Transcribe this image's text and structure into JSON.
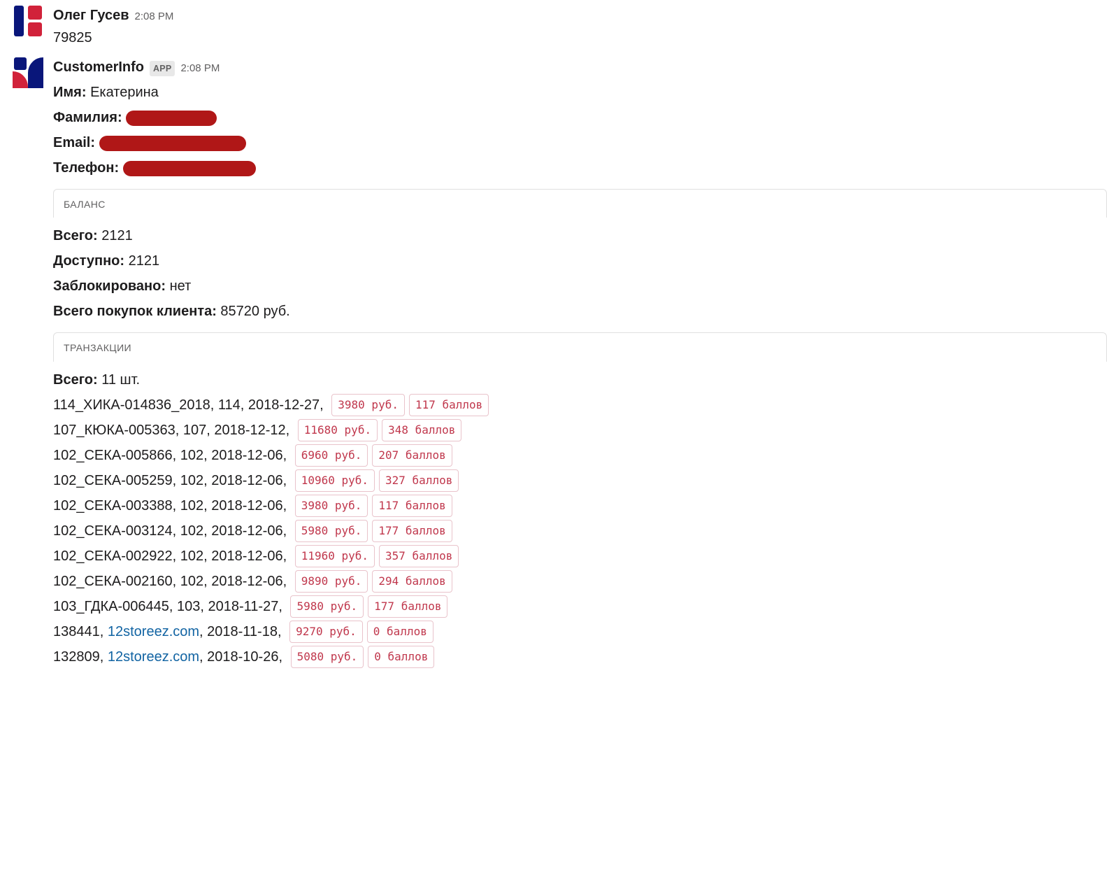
{
  "colors": {
    "redact": "#b01717",
    "tag_border": "#e9c3cb",
    "tag_text": "#c0374c",
    "link": "#1264a3"
  },
  "msg1": {
    "sender": "Олег Гусев",
    "time": "2:08 PM",
    "text": "79825"
  },
  "msg2": {
    "sender": "CustomerInfo",
    "app_badge": "APP",
    "time": "2:08 PM",
    "name_label": "Имя:",
    "name_value": "Екатерина",
    "surname_label": "Фамилия:",
    "email_label": "Email:",
    "phone_label": "Телефон:"
  },
  "balance": {
    "header": "БАЛАНС",
    "total_label": "Всего:",
    "total_value": "2121",
    "available_label": "Доступно:",
    "available_value": "2121",
    "blocked_label": "Заблокировано:",
    "blocked_value": "нет",
    "purchases_label": "Всего покупок клиента:",
    "purchases_value": "85720 руб."
  },
  "tx": {
    "header": "ТРАНЗАКЦИИ",
    "total_label": "Всего:",
    "total_value": "11 шт.",
    "items": [
      {
        "prefix": "114_ХИКА-014836_2018, 114, 2018-12-27, ",
        "link": "",
        "suffix": "",
        "amount": "3980 руб.",
        "points": "117 баллов"
      },
      {
        "prefix": "107_КЮКА-005363, 107, 2018-12-12, ",
        "link": "",
        "suffix": "",
        "amount": "11680 руб.",
        "points": "348 баллов"
      },
      {
        "prefix": "102_СЕКА-005866, 102, 2018-12-06, ",
        "link": "",
        "suffix": "",
        "amount": "6960 руб.",
        "points": "207 баллов"
      },
      {
        "prefix": "102_СЕКА-005259, 102, 2018-12-06, ",
        "link": "",
        "suffix": "",
        "amount": "10960 руб.",
        "points": "327 баллов"
      },
      {
        "prefix": "102_СЕКА-003388, 102, 2018-12-06, ",
        "link": "",
        "suffix": "",
        "amount": "3980 руб.",
        "points": "117 баллов"
      },
      {
        "prefix": "102_СЕКА-003124, 102, 2018-12-06, ",
        "link": "",
        "suffix": "",
        "amount": "5980 руб.",
        "points": "177 баллов"
      },
      {
        "prefix": "102_СЕКА-002922, 102, 2018-12-06, ",
        "link": "",
        "suffix": "",
        "amount": "11960 руб.",
        "points": "357 баллов"
      },
      {
        "prefix": "102_СЕКА-002160, 102, 2018-12-06, ",
        "link": "",
        "suffix": "",
        "amount": "9890 руб.",
        "points": "294 баллов"
      },
      {
        "prefix": "103_ГДКА-006445, 103, 2018-11-27, ",
        "link": "",
        "suffix": "",
        "amount": "5980 руб.",
        "points": "177 баллов"
      },
      {
        "prefix": "138441, ",
        "link": "12storeez.com",
        "suffix": ", 2018-11-18, ",
        "amount": "9270 руб.",
        "points": "0 баллов"
      },
      {
        "prefix": "132809, ",
        "link": "12storeez.com",
        "suffix": ", 2018-10-26, ",
        "amount": "5080 руб.",
        "points": "0 баллов"
      }
    ]
  }
}
